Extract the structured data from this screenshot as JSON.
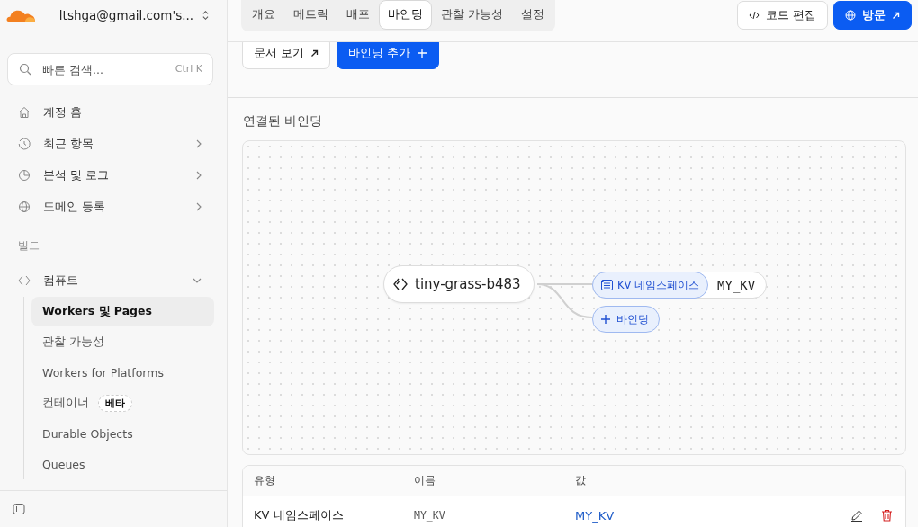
{
  "account": {
    "name": "ltshga@gmail.com's..."
  },
  "search": {
    "placeholder": "빠른 검색...",
    "shortcut": "Ctrl K"
  },
  "nav": [
    {
      "label": "계정 홈",
      "kind": "link"
    },
    {
      "label": "최근 항목",
      "kind": "menu"
    },
    {
      "label": "분석 및 로그",
      "kind": "menu"
    },
    {
      "label": "도메인 등록",
      "kind": "menu"
    }
  ],
  "section_label": "빌드",
  "compute": {
    "label": "컴퓨트",
    "expanded": true,
    "children": [
      {
        "label": "Workers 및 Pages",
        "selected": true
      },
      {
        "label": "관찰 가능성",
        "selected": false
      },
      {
        "label": "Workers for Platforms",
        "selected": false
      },
      {
        "label": "컨테이너",
        "selected": false,
        "badge": "베타"
      },
      {
        "label": "Durable Objects",
        "selected": false
      },
      {
        "label": "Queues",
        "selected": false
      }
    ]
  },
  "tabs": [
    {
      "label": "개요",
      "selected": false
    },
    {
      "label": "메트릭",
      "selected": false
    },
    {
      "label": "배포",
      "selected": false
    },
    {
      "label": "바인딩",
      "selected": true
    },
    {
      "label": "관찰 가능성",
      "selected": false
    },
    {
      "label": "설정",
      "selected": false
    }
  ],
  "header_buttons": [
    {
      "label": "코드 편집",
      "kind": "secondary"
    },
    {
      "label": "방문",
      "kind": "primary"
    }
  ],
  "actions": [
    {
      "label": "문서 보기",
      "kind": "secondary"
    },
    {
      "label": "바인딩 추가",
      "kind": "primary"
    }
  ],
  "section_title": "연결된 바인딩",
  "graph": {
    "worker": "tiny-grass-b483",
    "bindings": [
      {
        "type": "KV 네임스페이스",
        "name": "MY_KV"
      }
    ],
    "add_label": "바인딩"
  },
  "table": {
    "columns": [
      "유형",
      "이름",
      "값"
    ],
    "rows": [
      {
        "type": "KV 네임스페이스",
        "name": "MY_KV",
        "value": "MY_KV"
      }
    ]
  }
}
